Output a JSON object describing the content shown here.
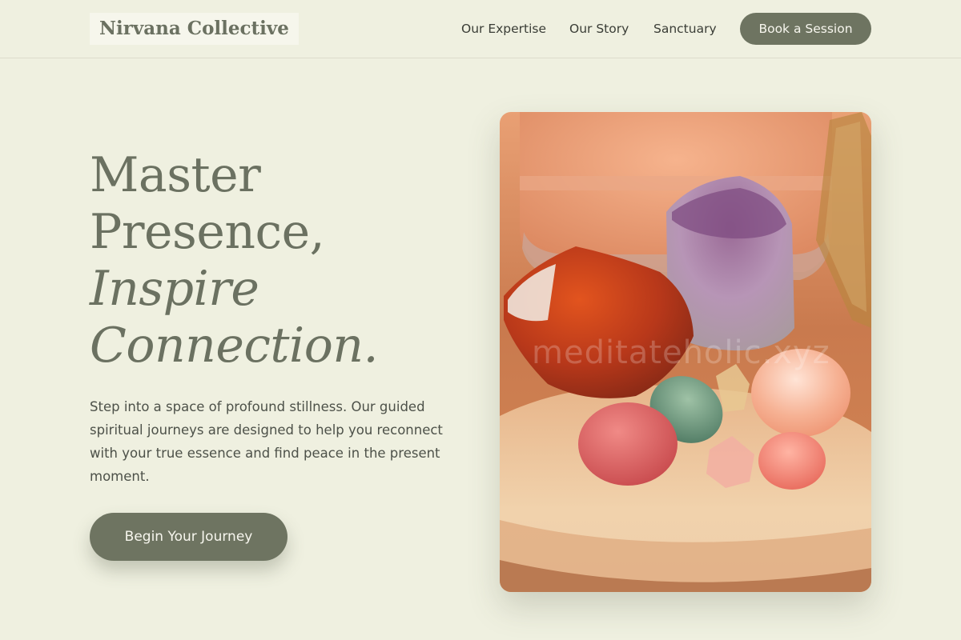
{
  "header": {
    "logo": "Nirvana Collective",
    "nav": [
      "Our Expertise",
      "Our Story",
      "Sanctuary"
    ],
    "cta_label": "Book a Session"
  },
  "hero": {
    "title_lines": [
      "Master",
      "Presence,",
      "Inspire",
      "Connection."
    ],
    "description": "Step into a space of profound stillness. Our guided spiritual journeys are designed to help you reconnect with your true essence and find peace in the present moment.",
    "cta_label": "Begin Your Journey",
    "image_watermark": "meditateholic.xyz"
  },
  "colors": {
    "background": "#eff0e0",
    "accent": "#6e7461",
    "heading": "#6b7161"
  },
  "icons": {
    "hero_image": "crystals-photo"
  }
}
